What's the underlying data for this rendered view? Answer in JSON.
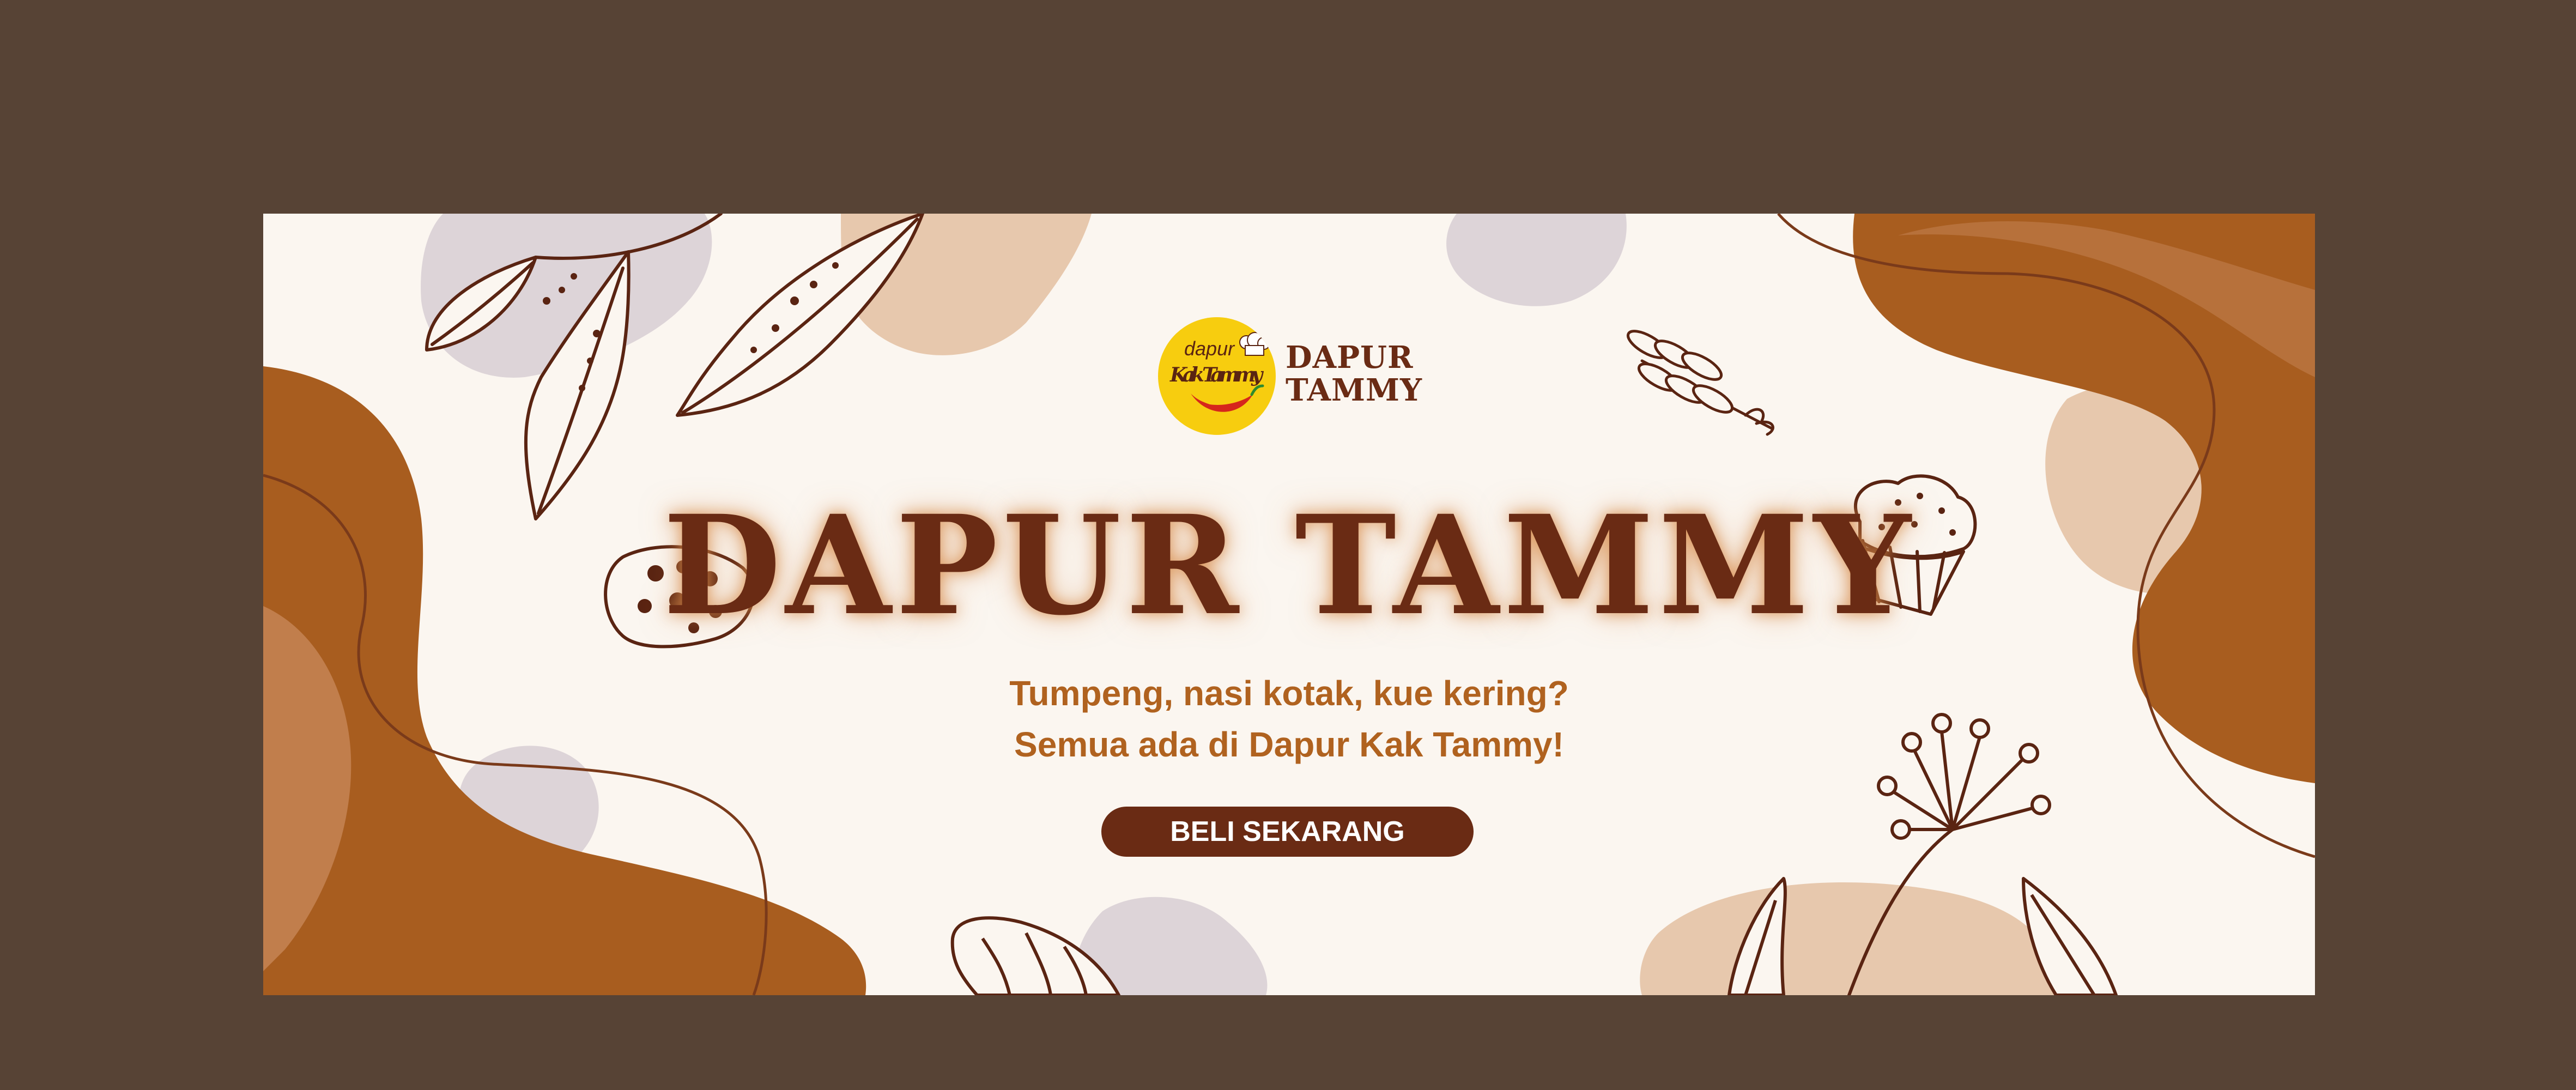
{
  "brand": {
    "logo_line1": "dapur",
    "logo_line2": "Kak Tammy",
    "name_line1": "DAPUR",
    "name_line2": "TAMMY"
  },
  "hero": {
    "headline": "DAPUR TAMMY",
    "tagline_line1": "Tumpeng, nasi kotak, kue kering?",
    "tagline_line2": "Semua ada di Dapur Kak Tammy!"
  },
  "cta": {
    "label": "BELI SEKARANG"
  },
  "colors": {
    "page_background": "#574335",
    "banner_background": "#fbf6f0",
    "brown_dark": "#6a2b14",
    "orange_brown": "#a85d1f",
    "peach": "#e7c8ad",
    "lilac": "#ddd4d8",
    "logo_yellow": "#f7cd0f"
  },
  "icons": [
    "leaf-branch-icon",
    "wheat-icon",
    "cookie-icon",
    "muffin-icon",
    "flower-branch-icon",
    "bread-icon",
    "leaf-icon"
  ]
}
